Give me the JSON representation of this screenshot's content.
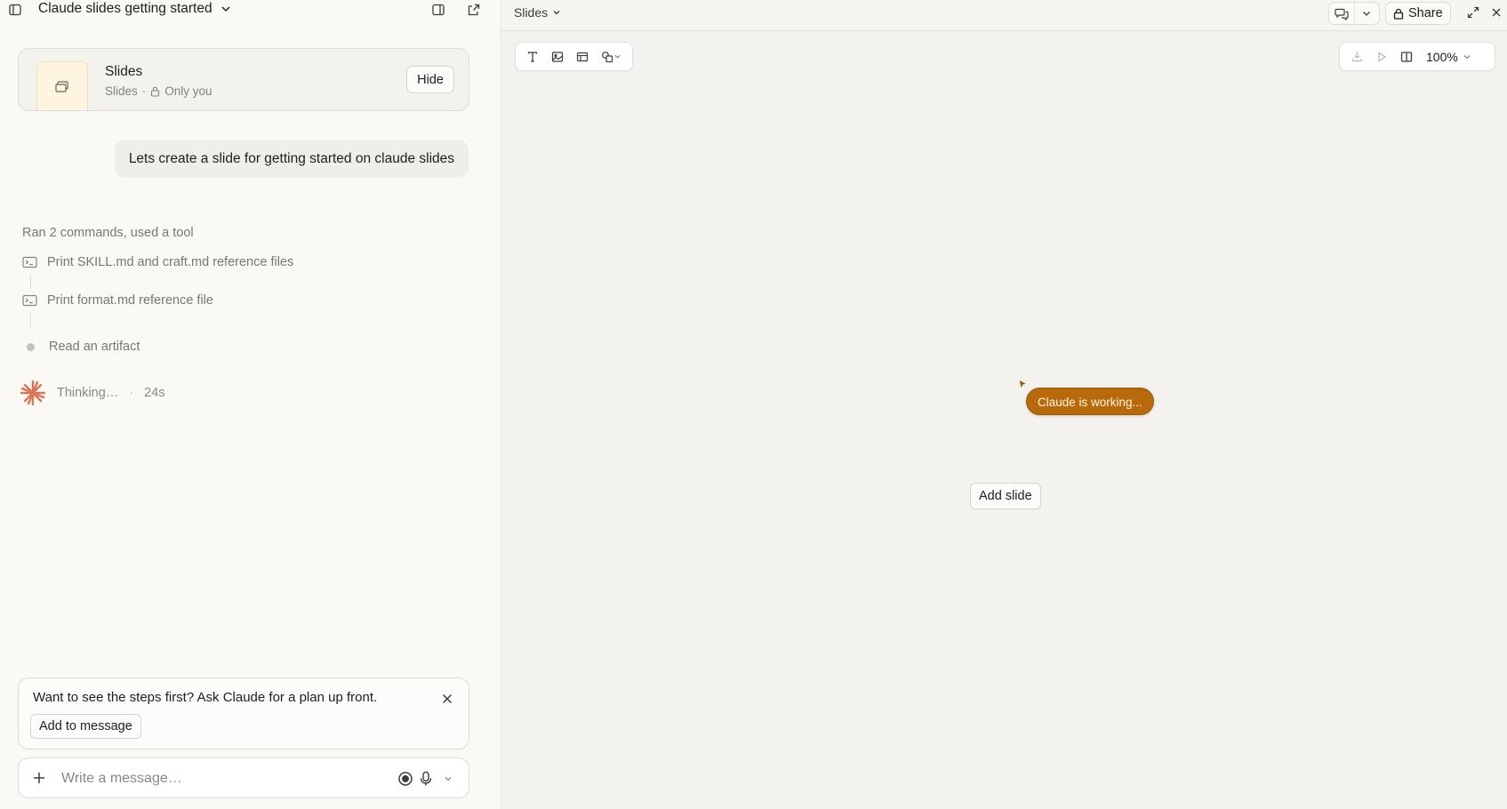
{
  "chat": {
    "title": "Claude slides getting started",
    "artifact_card": {
      "title": "Slides",
      "type": "Slides",
      "separator": "·",
      "visibility": "Only you",
      "hide_label": "Hide"
    },
    "user_message": "Lets create a slide for getting started on claude slides",
    "tool_summary": "Ran 2 commands, used a tool",
    "steps": [
      {
        "label": "Print SKILL.md and craft.md reference files",
        "icon": "terminal-icon"
      },
      {
        "label": "Print format.md reference file",
        "icon": "terminal-icon"
      },
      {
        "label": "Read an artifact",
        "icon": "dot"
      }
    ],
    "thinking": {
      "label": "Thinking…",
      "separator": "·",
      "elapsed": "24s"
    },
    "tip": {
      "text": "Want to see the steps first? Ask Claude for a plan up front.",
      "action_label": "Add to message"
    },
    "composer": {
      "placeholder": "Write a message…"
    }
  },
  "artifact_pane": {
    "title": "Slides",
    "share_label": "Share",
    "zoom": "100%",
    "working_badge": "Claude is working...",
    "add_slide_label": "Add slide"
  },
  "colors": {
    "accent_orange": "#d97757",
    "working_badge": "#b8690a",
    "panel_bg": "#faf9f5",
    "canvas_bg": "#f3f2ee"
  }
}
